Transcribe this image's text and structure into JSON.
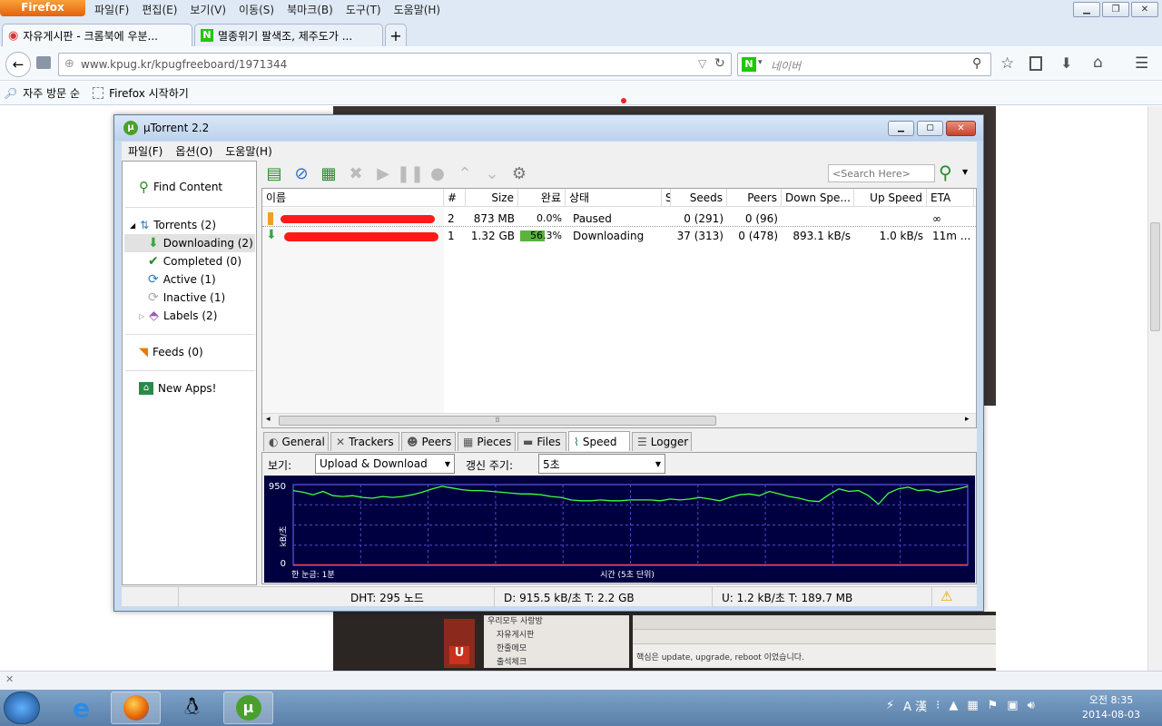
{
  "firefox": {
    "app_button": "Firefox",
    "menu": [
      "파일(F)",
      "편집(E)",
      "보기(V)",
      "이동(S)",
      "북마크(B)",
      "도구(T)",
      "도움말(H)"
    ],
    "tabs": [
      {
        "label": "자유게시판 - 크롬북에 우분..."
      },
      {
        "label": "멸종위기 팔색조, 제주도가 ..."
      }
    ],
    "url": "www.kpug.kr/kpugfreeboard/1971344",
    "search_placeholder": "네이버",
    "bookmarks": [
      "자주 방문 순",
      "Firefox 시작하기"
    ]
  },
  "utorrent": {
    "title": "µTorrent 2.2",
    "menu": [
      "파일(F)",
      "옵션(O)",
      "도움말(H)"
    ],
    "search_placeholder": "<Search Here>",
    "sidebar": {
      "find_content": "Find Content",
      "torrents": "Torrents (2)",
      "downloading": "Downloading (2)",
      "completed": "Completed (0)",
      "active": "Active (1)",
      "inactive": "Inactive (1)",
      "labels": "Labels (2)",
      "feeds": "Feeds (0)",
      "new_apps": "New Apps!"
    },
    "columns": {
      "name": "이름",
      "num": "#",
      "size": "Size",
      "done": "완료",
      "status": "상태",
      "s": "S",
      "seeds": "Seeds",
      "peers": "Peers",
      "down": "Down Spe...",
      "up": "Up Speed",
      "eta": "ETA"
    },
    "rows": [
      {
        "num": "2",
        "size": "873 MB",
        "done": "0.0%",
        "progress": 0,
        "status": "Paused",
        "seeds": "0 (291)",
        "peers": "0 (96)",
        "down": "",
        "up": "",
        "eta": "∞"
      },
      {
        "num": "1",
        "size": "1.32 GB",
        "done": "56.3%",
        "progress": 56.3,
        "status": "Downloading",
        "seeds": "37 (313)",
        "peers": "0 (478)",
        "down": "893.1 kB/s",
        "up": "1.0 kB/s",
        "eta": "11m ..."
      }
    ],
    "detail_tabs": [
      "General",
      "Trackers",
      "Peers",
      "Pieces",
      "Files",
      "Speed",
      "Logger"
    ],
    "speed": {
      "view_label": "보기:",
      "view_value": "Upload & Download",
      "interval_label": "갱신 주기:",
      "interval_value": "5초"
    },
    "status": {
      "dht": "DHT: 295 노드",
      "down": "D: 915.5 kB/초 T: 2.2 GB",
      "up": "U: 1.2 kB/초 T: 189.7 MB"
    }
  },
  "chart_data": {
    "type": "line",
    "ylabel": "kB/초",
    "xlabel": "시간 (5초 단위)",
    "grid_label": "한 눈금: 1분",
    "ylim": [
      0,
      950
    ],
    "yticks": [
      "950",
      "0"
    ],
    "series": [
      {
        "values": [
          880,
          860,
          830,
          870,
          820,
          810,
          820,
          800,
          790,
          810,
          800,
          810,
          830,
          860,
          900,
          930,
          910,
          890,
          880,
          880,
          870,
          860,
          850,
          840,
          840,
          830,
          810,
          800,
          770,
          760,
          760,
          770,
          760,
          760,
          770,
          770,
          770,
          760,
          780,
          770,
          780,
          800,
          780,
          760,
          800,
          830,
          840,
          820,
          870,
          840,
          810,
          790,
          760,
          750,
          830,
          900,
          870,
          880,
          820,
          720,
          850,
          900,
          920,
          880,
          890,
          860,
          880,
          900,
          930
        ]
      },
      {
        "values": [
          8,
          8,
          8,
          8,
          8,
          8,
          8,
          8,
          8,
          8,
          8,
          8,
          8,
          8,
          8,
          8,
          8,
          8,
          8,
          8,
          8,
          8,
          8,
          8,
          8,
          8,
          8,
          8,
          8,
          8,
          8,
          8,
          8,
          8,
          8,
          8,
          8,
          8,
          8,
          8,
          8,
          8,
          8,
          8,
          8,
          8,
          8,
          8,
          8,
          8,
          8,
          8,
          8,
          8,
          8,
          8,
          8,
          8,
          8,
          8,
          8,
          8,
          8,
          8,
          8,
          8,
          8,
          8,
          8
        ]
      }
    ]
  },
  "taskbar": {
    "clock_time": "오전 8:35",
    "clock_date": "2014-08-03",
    "ime": "A 漢"
  },
  "web": {
    "snippet": "핵심은 update, upgrade, reboot 이었습니다.",
    "menu1": "우리모두 사랑방",
    "menu2": "자유게시판",
    "menu3": "한줄메모",
    "menu4": "출석체크"
  }
}
